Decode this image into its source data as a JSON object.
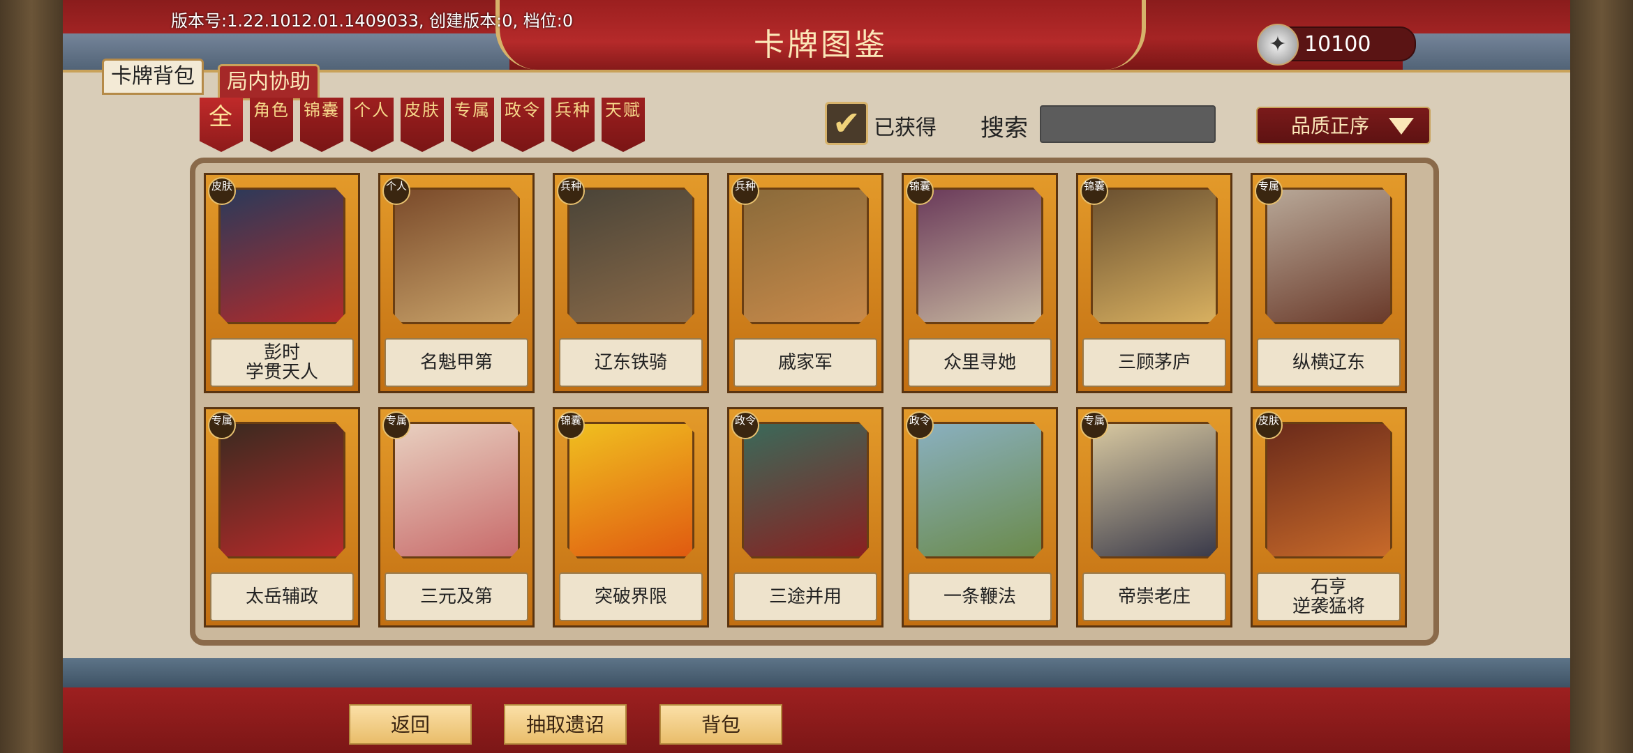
{
  "header": {
    "version_text": "版本号:1.22.1012.01.1409033, 创建版本:0, 档位:0",
    "title": "卡牌图鉴",
    "currency_value": "10100",
    "currency_icon": "silver-feather-icon"
  },
  "tabs": [
    {
      "label": "卡牌背包",
      "active": true
    },
    {
      "label": "局内协助",
      "active": false
    }
  ],
  "filters": [
    "全",
    "角色",
    "锦囊",
    "个人",
    "皮肤",
    "专属",
    "政令",
    "兵种",
    "天赋"
  ],
  "controls": {
    "owned_label": "已获得",
    "owned_checked": true,
    "search_label": "搜索",
    "search_value": "",
    "sort_label": "品质正序"
  },
  "cards": [
    {
      "badge": "皮肤",
      "name": "彭时\n学贯天人",
      "art_colors": [
        "#2a3a5a",
        "#b22a2a"
      ]
    },
    {
      "badge": "个人",
      "name": "名魁甲第",
      "art_colors": [
        "#7a4a2a",
        "#c9a36a"
      ]
    },
    {
      "badge": "兵种",
      "name": "辽东铁骑",
      "art_colors": [
        "#4a4438",
        "#8a6a48"
      ]
    },
    {
      "badge": "兵种",
      "name": "戚家军",
      "art_colors": [
        "#8a6a3a",
        "#c88a4a"
      ]
    },
    {
      "badge": "锦囊",
      "name": "众里寻她",
      "art_colors": [
        "#6a3a5a",
        "#c8b8a0"
      ]
    },
    {
      "badge": "锦囊",
      "name": "三顾茅庐",
      "art_colors": [
        "#6a5030",
        "#d8b060"
      ]
    },
    {
      "badge": "专属",
      "name": "纵横辽东",
      "art_colors": [
        "#b8a898",
        "#6a3a2a"
      ]
    },
    {
      "badge": "专属",
      "name": "太岳辅政",
      "art_colors": [
        "#3a2a20",
        "#b82a2a"
      ]
    },
    {
      "badge": "专属",
      "name": "三元及第",
      "art_colors": [
        "#e8d0c0",
        "#c86a6a"
      ]
    },
    {
      "badge": "锦囊",
      "name": "突破界限",
      "art_colors": [
        "#f0c020",
        "#e05a10"
      ]
    },
    {
      "badge": "政令",
      "name": "三途并用",
      "art_colors": [
        "#3a6a5a",
        "#8a2020"
      ]
    },
    {
      "badge": "政令",
      "name": "一条鞭法",
      "art_colors": [
        "#8ab0c0",
        "#6a8a4a"
      ]
    },
    {
      "badge": "专属",
      "name": "帝崇老庄",
      "art_colors": [
        "#d8c8a0",
        "#3a3a4a"
      ]
    },
    {
      "badge": "皮肤",
      "name": "石亨\n逆袭猛将",
      "art_colors": [
        "#6a2a1a",
        "#c86a2a"
      ]
    }
  ],
  "bottom_buttons": [
    "返回",
    "抽取遗诏",
    "背包"
  ]
}
